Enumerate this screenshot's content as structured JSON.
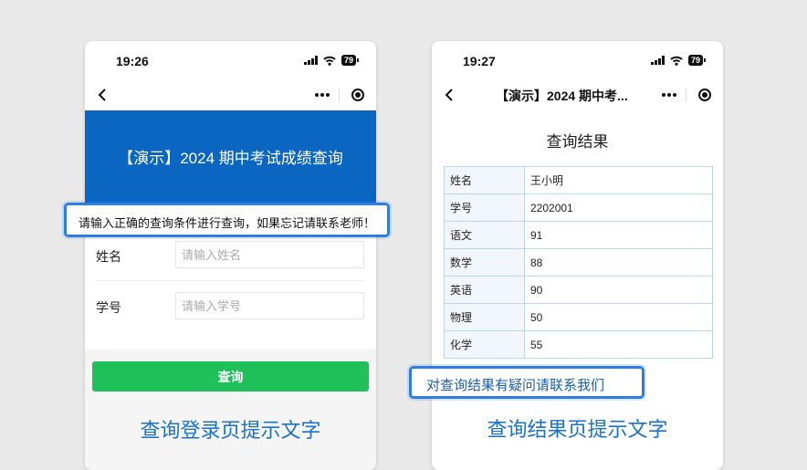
{
  "left_phone": {
    "time": "19:26",
    "battery": "79",
    "banner_title": "【演示】2024 期中考试成绩查询",
    "form": {
      "name_label": "姓名",
      "name_placeholder": "请输入姓名",
      "id_label": "学号",
      "id_placeholder": "请输入学号",
      "submit_label": "查询"
    },
    "hint": "查询登录页提示文字"
  },
  "right_phone": {
    "time": "19:27",
    "battery": "79",
    "nav_title": "【演示】2024 期中考...",
    "result_title": "查询结果",
    "table": [
      {
        "key": "姓名",
        "value": "王小明"
      },
      {
        "key": "学号",
        "value": "2202001"
      },
      {
        "key": "语文",
        "value": "91"
      },
      {
        "key": "数学",
        "value": "88"
      },
      {
        "key": "英语",
        "value": "90"
      },
      {
        "key": "物理",
        "value": "50"
      },
      {
        "key": "化学",
        "value": "55"
      }
    ],
    "hint": "查询结果页提示文字"
  },
  "callouts": {
    "login": "请输入正确的查询条件进行查询，如果忘记请联系老师！",
    "result": "对查询结果有疑问请联系我们"
  },
  "icons": {
    "back": "chevron-left-icon",
    "more": "more-dots-icon",
    "close": "target-close-icon",
    "signal": "signal-icon",
    "wifi": "wifi-icon",
    "battery": "battery-icon"
  },
  "colors": {
    "banner": "#0b66c2",
    "primary_button": "#1fbf5a",
    "hint_text": "#1a73c8",
    "callout_border": "#2e7de0"
  }
}
